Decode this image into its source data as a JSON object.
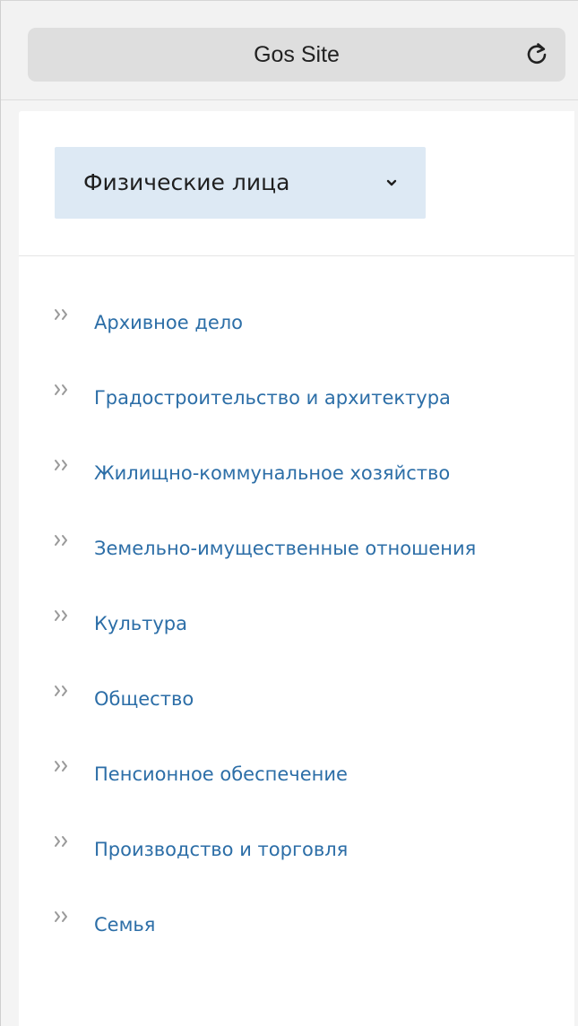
{
  "browser": {
    "site_title": "Gos Site"
  },
  "type_selector": {
    "value": "Физические лица"
  },
  "categories": [
    {
      "label": "Архивное дело"
    },
    {
      "label": "Градостроительство и архитектура"
    },
    {
      "label": "Жилищно-коммунальное хозяйство"
    },
    {
      "label": "Земельно-имущественные отношения"
    },
    {
      "label": "Культура"
    },
    {
      "label": "Общество"
    },
    {
      "label": "Пенсионное обеспечение"
    },
    {
      "label": "Производство и торговля"
    },
    {
      "label": "Семья"
    }
  ],
  "colors": {
    "link": "#2c6ea7",
    "selector_bg": "#dde9f4",
    "bullet": "#9a9a9a"
  },
  "icons": {
    "reload": "reload-icon",
    "chevron": "chevron-down-icon",
    "bullet": "double-chevron-right-icon"
  }
}
